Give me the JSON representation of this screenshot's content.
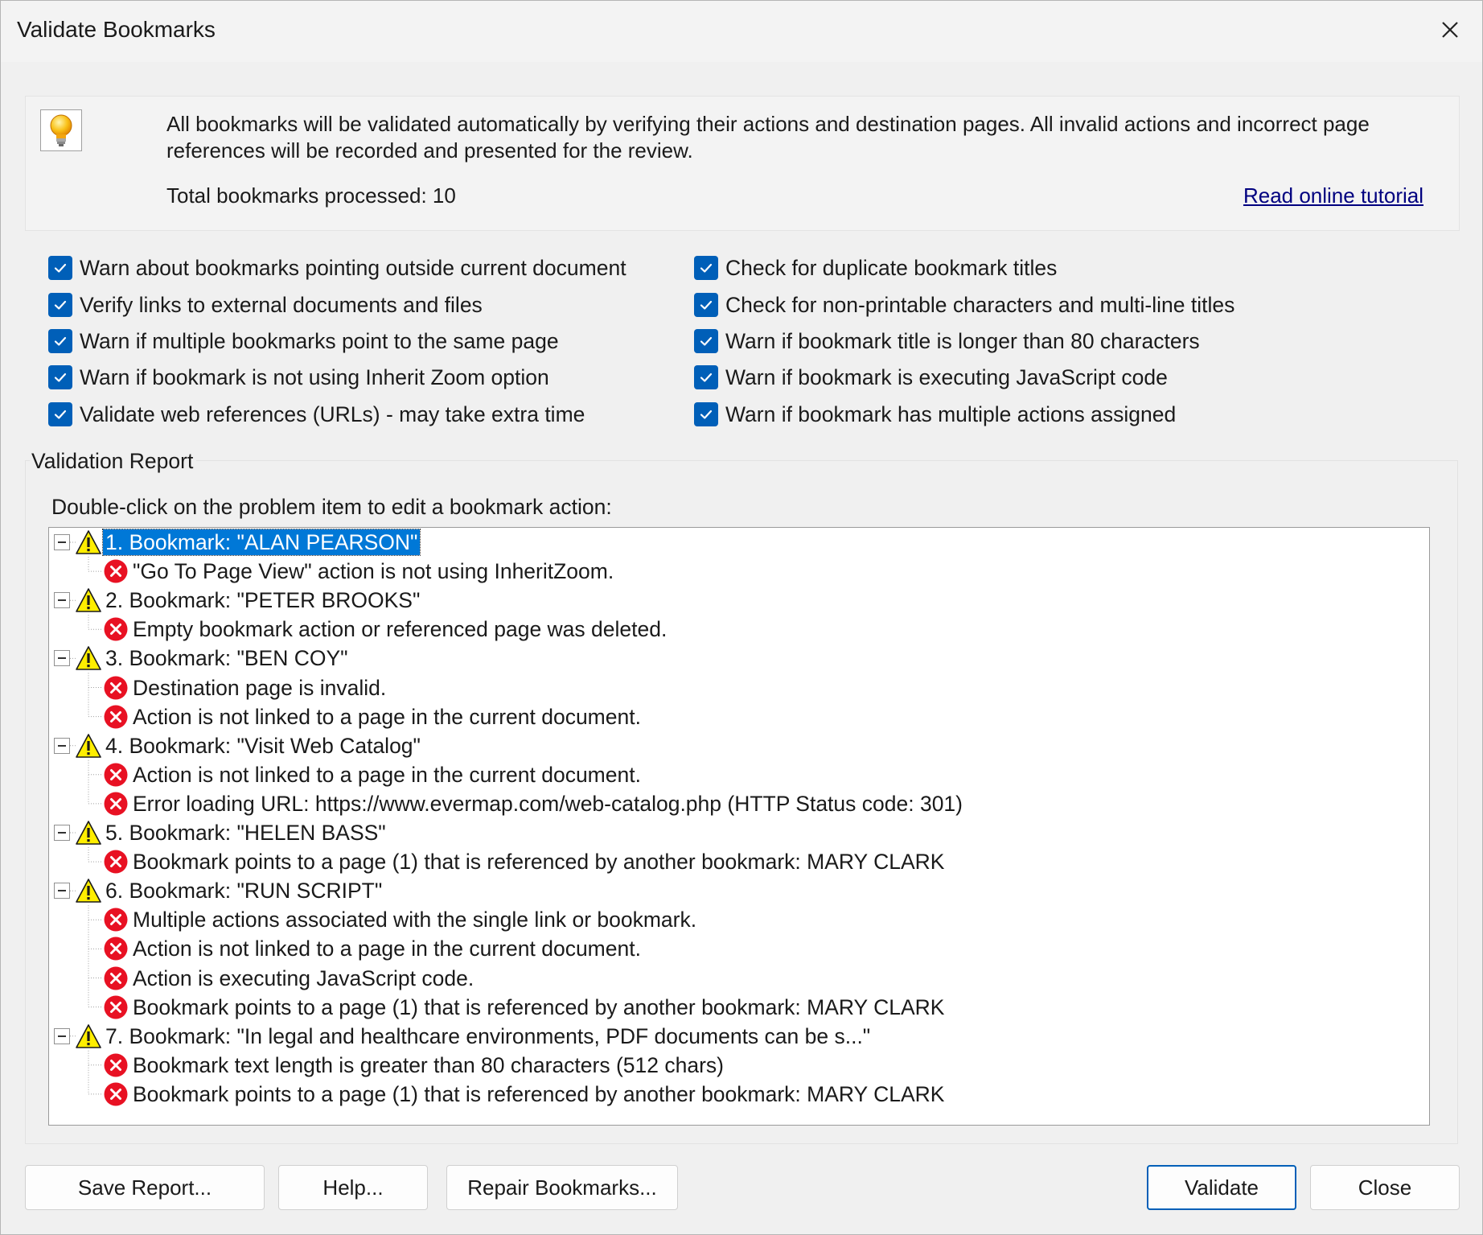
{
  "window": {
    "title": "Validate Bookmarks"
  },
  "info": {
    "description": "All bookmarks will be validated automatically by verifying their actions and destination pages. All invalid actions and incorrect page references will be recorded and presented for the review.",
    "count_label": "Total bookmarks processed: 10",
    "tutorial_link": "Read online tutorial"
  },
  "options": {
    "left": [
      {
        "label": "Warn about bookmarks pointing outside current document",
        "checked": true
      },
      {
        "label": "Verify links to external documents and files",
        "checked": true
      },
      {
        "label": "Warn if multiple bookmarks point to the same page",
        "checked": true
      },
      {
        "label": "Warn if bookmark is not using Inherit Zoom option",
        "checked": true
      },
      {
        "label": "Validate web references (URLs) - may take extra time",
        "checked": true
      }
    ],
    "right": [
      {
        "label": "Check for duplicate bookmark titles",
        "checked": true
      },
      {
        "label": "Check for non-printable characters and multi-line titles",
        "checked": true
      },
      {
        "label": "Warn if bookmark title is longer than 80 characters",
        "checked": true
      },
      {
        "label": "Warn if bookmark is executing JavaScript code",
        "checked": true
      },
      {
        "label": "Warn if bookmark has multiple actions assigned",
        "checked": true
      }
    ]
  },
  "report": {
    "group_label": "Validation Report",
    "instruction": "Double-click on the problem item to edit a bookmark action:",
    "items": [
      {
        "title": "1. Bookmark: \"ALAN PEARSON\"",
        "selected": true,
        "problems": [
          "\"Go To Page View\" action is not using InheritZoom."
        ]
      },
      {
        "title": "2. Bookmark: \"PETER BROOKS\"",
        "selected": false,
        "problems": [
          "Empty bookmark action or referenced page was deleted."
        ]
      },
      {
        "title": "3. Bookmark: \"BEN COY\"",
        "selected": false,
        "problems": [
          "Destination page is invalid.",
          "Action is not linked to a page in the current document."
        ]
      },
      {
        "title": "4. Bookmark: \"Visit Web Catalog\"",
        "selected": false,
        "problems": [
          "Action is not linked to a page in the current document.",
          "Error loading URL: https://www.evermap.com/web-catalog.php (HTTP Status code: 301)"
        ]
      },
      {
        "title": "5. Bookmark: \"HELEN BASS\"",
        "selected": false,
        "problems": [
          "Bookmark points to a page (1) that is referenced by another bookmark: MARY CLARK"
        ]
      },
      {
        "title": "6. Bookmark: \"RUN SCRIPT\"",
        "selected": false,
        "problems": [
          "Multiple actions associated with the single link or bookmark.",
          "Action is not linked to a page in the current document.",
          "Action is executing JavaScript code.",
          "Bookmark points to a page (1) that is referenced by another bookmark: MARY CLARK"
        ]
      },
      {
        "title": "7. Bookmark: \"In legal and healthcare environments, PDF documents can be s...\"",
        "selected": false,
        "problems": [
          "Bookmark text length is greater than 80 characters (512 chars)",
          "Bookmark points to a page (1) that is referenced by another bookmark: MARY CLARK"
        ]
      }
    ]
  },
  "buttons": {
    "save_report": "Save Report...",
    "help": "Help...",
    "repair": "Repair Bookmarks...",
    "validate": "Validate",
    "close": "Close"
  },
  "colors": {
    "accent": "#005fb8",
    "selection": "#0078d7",
    "error": "#e81123",
    "warning": "#ffee00",
    "link": "#00007f"
  }
}
